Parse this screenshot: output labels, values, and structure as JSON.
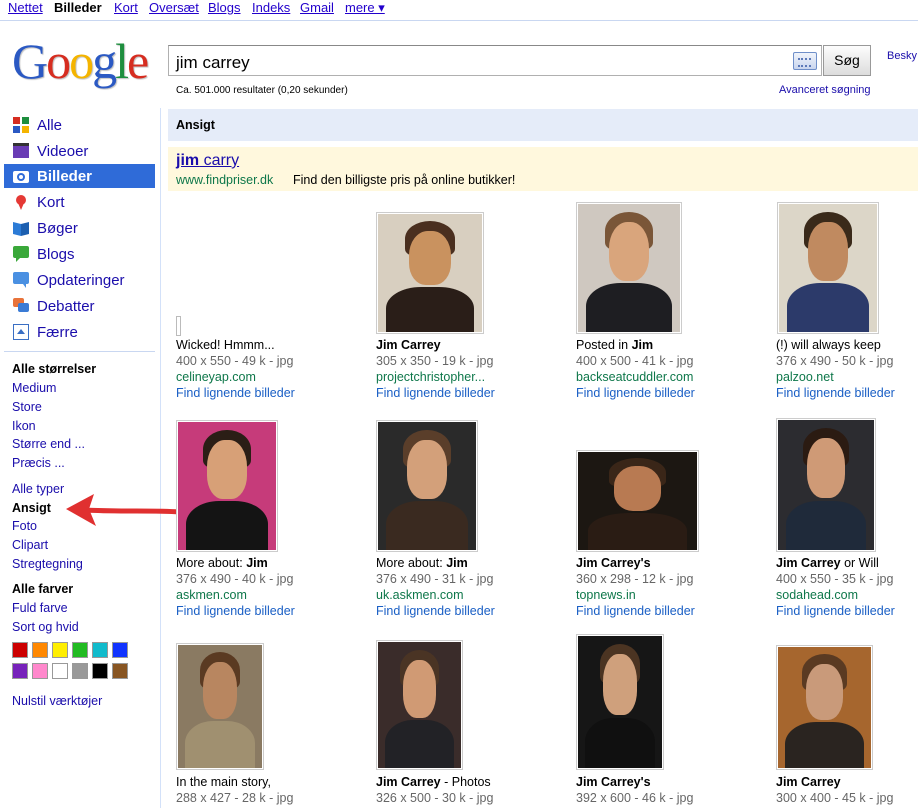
{
  "topnav": {
    "items": [
      "Nettet",
      "Billeder",
      "Kort",
      "Oversæt",
      "Blogs",
      "Indeks",
      "Gmail",
      "mere ▾"
    ]
  },
  "logo": {
    "letters": [
      "G",
      "o",
      "o",
      "g",
      "l",
      "e"
    ],
    "colors": [
      "#2b59c3",
      "#d62d20",
      "#f4b400",
      "#2b59c3",
      "#1e8e3e",
      "#d62d20"
    ]
  },
  "search": {
    "query": "jim carrey",
    "button": "Søg",
    "besky": "Besky",
    "stats": "Ca. 501.000 resultater (0,20 sekunder)",
    "advanced": "Avanceret søgning"
  },
  "sidebar": {
    "nav": [
      {
        "label": "Alle",
        "icon": "all-icon"
      },
      {
        "label": "Videoer",
        "icon": "video-icon"
      },
      {
        "label": "Billeder",
        "icon": "camera-icon"
      },
      {
        "label": "Kort",
        "icon": "map-pin-icon"
      },
      {
        "label": "Bøger",
        "icon": "book-icon"
      },
      {
        "label": "Blogs",
        "icon": "blog-icon"
      },
      {
        "label": "Opdateringer",
        "icon": "updates-icon"
      },
      {
        "label": "Debatter",
        "icon": "discussion-icon"
      },
      {
        "label": "Færre",
        "icon": "collapse-icon"
      }
    ],
    "sizes": {
      "heading": "Alle størrelser",
      "items": [
        "Medium",
        "Store",
        "Ikon",
        "Større end ...",
        "Præcis ..."
      ]
    },
    "types": {
      "items": [
        "Alle typer",
        "Ansigt",
        "Foto",
        "Clipart",
        "Stregtegning"
      ]
    },
    "colors": {
      "heading": "Alle farver",
      "items": [
        "Fuld farve",
        "Sort og hvid"
      ],
      "swatches": [
        "#cc0000",
        "#ff8800",
        "#ffee00",
        "#22bb22",
        "#11bbcc",
        "#1133ff",
        "#7722bb",
        "#ff88cc",
        "#ffffff",
        "#999999",
        "#000000",
        "#885522"
      ]
    },
    "reset": "Nulstil værktøjer"
  },
  "section_header": "Ansigt",
  "ad": {
    "title_link": "jim",
    "title_rest": " carry",
    "url": "www.findpriser.dk",
    "desc": "Find den billigste pris på online butikker!"
  },
  "similar_label": "Find lignende billeder",
  "results": [
    {
      "cap_pre": "Wicked! Hmmm...",
      "cap_bold": "",
      "cap_post": "",
      "meta": "400 x 550 - 49 k - jpg",
      "url": "celineyap.com"
    },
    {
      "cap_pre": "",
      "cap_bold": "Jim Carrey",
      "cap_post": "",
      "meta": "305 x 350 - 19 k - jpg",
      "url": "projectchristopher..."
    },
    {
      "cap_pre": "Posted in ",
      "cap_bold": "Jim",
      "cap_post": "",
      "meta": "400 x 500 - 41 k - jpg",
      "url": "backseatcuddler.com"
    },
    {
      "cap_pre": "(!) will always keep",
      "cap_bold": "",
      "cap_post": "",
      "meta": "376 x 490 - 50 k - jpg",
      "url": "palzoo.net"
    },
    {
      "cap_pre": "More about: ",
      "cap_bold": "Jim",
      "cap_post": "",
      "meta": "376 x 490 - 40 k - jpg",
      "url": "askmen.com"
    },
    {
      "cap_pre": "More about: ",
      "cap_bold": "Jim",
      "cap_post": "",
      "meta": "376 x 490 - 31 k - jpg",
      "url": "uk.askmen.com"
    },
    {
      "cap_pre": "",
      "cap_bold": "Jim Carrey's",
      "cap_post": "",
      "meta": "360 x 298 - 12 k - jpg",
      "url": "topnews.in"
    },
    {
      "cap_pre": "",
      "cap_bold": "Jim Carrey",
      "cap_post": " or Will",
      "meta": "400 x 550 - 35 k - jpg",
      "url": "sodahead.com"
    },
    {
      "cap_pre": "In the main story,",
      "cap_bold": "",
      "cap_post": "",
      "meta": "288 x 427 - 28 k - jpg",
      "url": ""
    },
    {
      "cap_pre": "",
      "cap_bold": "Jim Carrey",
      "cap_post": " - Photos",
      "meta": "326 x 500 - 30 k - jpg",
      "url": ""
    },
    {
      "cap_pre": "",
      "cap_bold": "Jim Carrey's",
      "cap_post": "",
      "meta": "392 x 600 - 46 k - jpg",
      "url": ""
    },
    {
      "cap_pre": "",
      "cap_bold": "Jim Carrey",
      "cap_post": "",
      "meta": "300 x 400 - 45 k - jpg",
      "url": ""
    }
  ]
}
